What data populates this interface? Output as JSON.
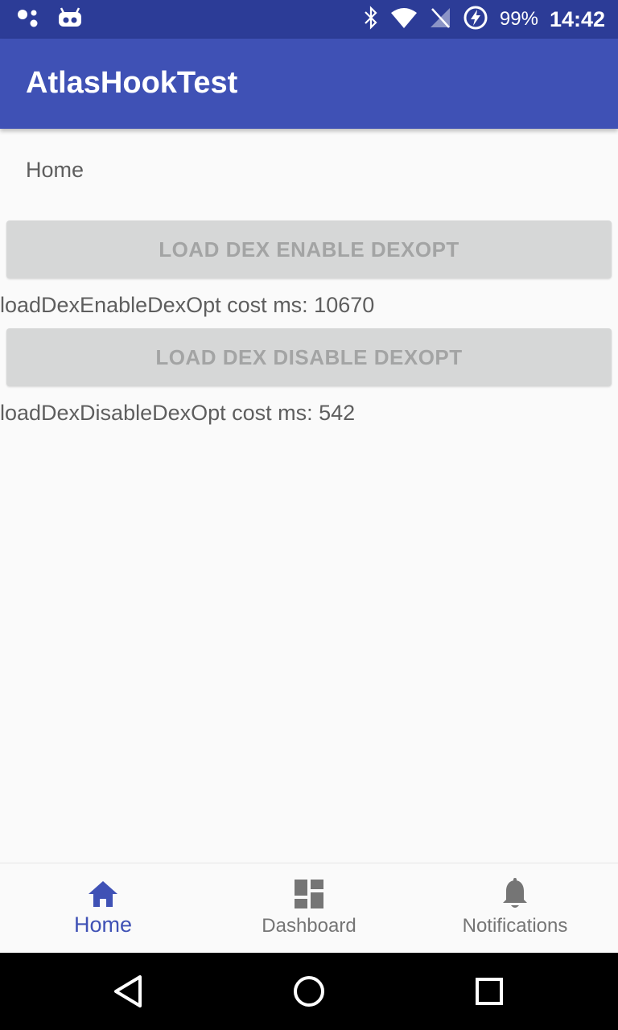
{
  "status_bar": {
    "battery_percent": "99%",
    "time": "14:42",
    "icons": [
      "assistant-dots-icon",
      "android-robot-icon",
      "bluetooth-icon",
      "wifi-icon",
      "no-signal-icon",
      "battery-charging-icon"
    ]
  },
  "app_bar": {
    "title": "AtlasHookTest"
  },
  "main": {
    "section_label": "Home",
    "enable_button_label": "LOAD DEX ENABLE DEXOPT",
    "enable_result": "loadDexEnableDexOpt cost ms: 10670",
    "disable_button_label": "LOAD DEX DISABLE DEXOPT",
    "disable_result": "loadDexDisableDexOpt cost ms: 542"
  },
  "bottom_nav": {
    "items": [
      {
        "label": "Home",
        "icon": "home-icon",
        "active": true
      },
      {
        "label": "Dashboard",
        "icon": "dashboard-icon",
        "active": false
      },
      {
        "label": "Notifications",
        "icon": "bell-icon",
        "active": false
      }
    ]
  },
  "colors": {
    "primary": "#3f51b5",
    "primary_dark": "#2c3c97",
    "button_disabled": "#d6d7d7",
    "inactive": "#757575"
  },
  "system_nav": {
    "icons": [
      "back-icon",
      "home-circle-icon",
      "recents-icon"
    ]
  }
}
